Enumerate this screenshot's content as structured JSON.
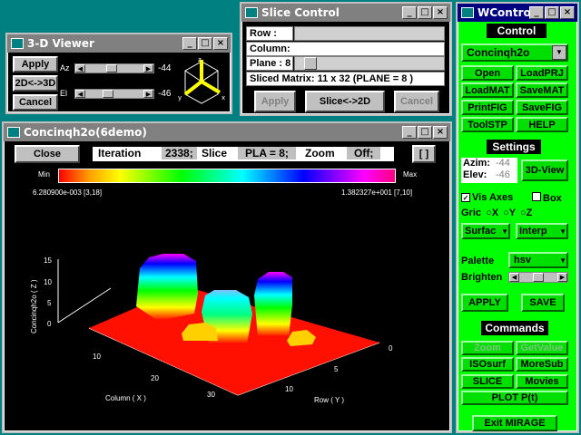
{
  "viewer": {
    "title": "3-D Viewer",
    "apply": "Apply",
    "toggle": "2D<->3D",
    "cancel": "Cancel",
    "az_label": "Az",
    "az_value": "-44",
    "el_label": "El",
    "el_value": "-46",
    "axis_x": "x",
    "axis_y": "y",
    "axis_z": "z"
  },
  "slice": {
    "title": "Slice Control",
    "row_label": "Row    :",
    "col_label": "Column:",
    "plane_label": "Plane   :  8",
    "matrix": "Sliced Matrix: 11 x 32   (PLANE = 8 )",
    "apply": "Apply",
    "toggle": "Slice<->2D",
    "cancel": "Cancel"
  },
  "main": {
    "title": "Concinqh2o(6demo)",
    "close": "Close",
    "iteration_label": "Iteration",
    "iteration_value": "2338;",
    "slice_label": "Slice",
    "slice_value": "PLA = 8;",
    "zoom_label": "Zoom",
    "zoom_value": "Off;",
    "bracket": "[ ]",
    "cmap_min": "Min",
    "cmap_max": "Max",
    "min_value": "6.280900e-003 [3,18]",
    "max_value": "1.382327e+001 [7,10]",
    "zlabel": "Concinqh2o ( Z )",
    "xlabel": "Column ( X )",
    "ylabel": "Row ( Y )",
    "zticks": [
      "15",
      "10",
      "5",
      "0"
    ],
    "xticks": [
      "10",
      "20",
      "30"
    ],
    "yticks": [
      "0",
      "5",
      "10"
    ]
  },
  "control": {
    "title": "WControl",
    "control_hdr": "Control",
    "dataset": "Concinqh2o",
    "buttons": [
      "Open",
      "LoadPRJ",
      "LoadMAT",
      "SaveMAT",
      "PrintFIG",
      "SaveFIG",
      "ToolSTP",
      "HELP"
    ],
    "settings_hdr": "Settings",
    "azim_label": "Azim:",
    "azim_value": "-44",
    "elev_label": "Elev:",
    "elev_value": "-46",
    "view3d": "3D-View",
    "vis_axes": "Vis Axes",
    "box": "Box",
    "grid_label": "Gric",
    "gx": "X",
    "gy": "Y",
    "gz": "Z",
    "surface": "Surfac",
    "interp": "Interp",
    "palette_label": "Palette",
    "palette_value": "hsv",
    "brighten_label": "Brighten",
    "apply": "APPLY",
    "save": "SAVE",
    "commands_hdr": "Commands",
    "zoom": "Zoom",
    "getvalue": "GetValue",
    "isosurf": "ISOsurf",
    "moresub": "MoreSub",
    "slice": "SLICE",
    "movies": "Movies",
    "plot": "PLOT  P(t)",
    "exit": "Exit MIRAGE"
  },
  "colors": {
    "desktop": "#008080",
    "panel": "#00ff00",
    "title_inactive": "#808080",
    "plot_bg": "#000000"
  }
}
